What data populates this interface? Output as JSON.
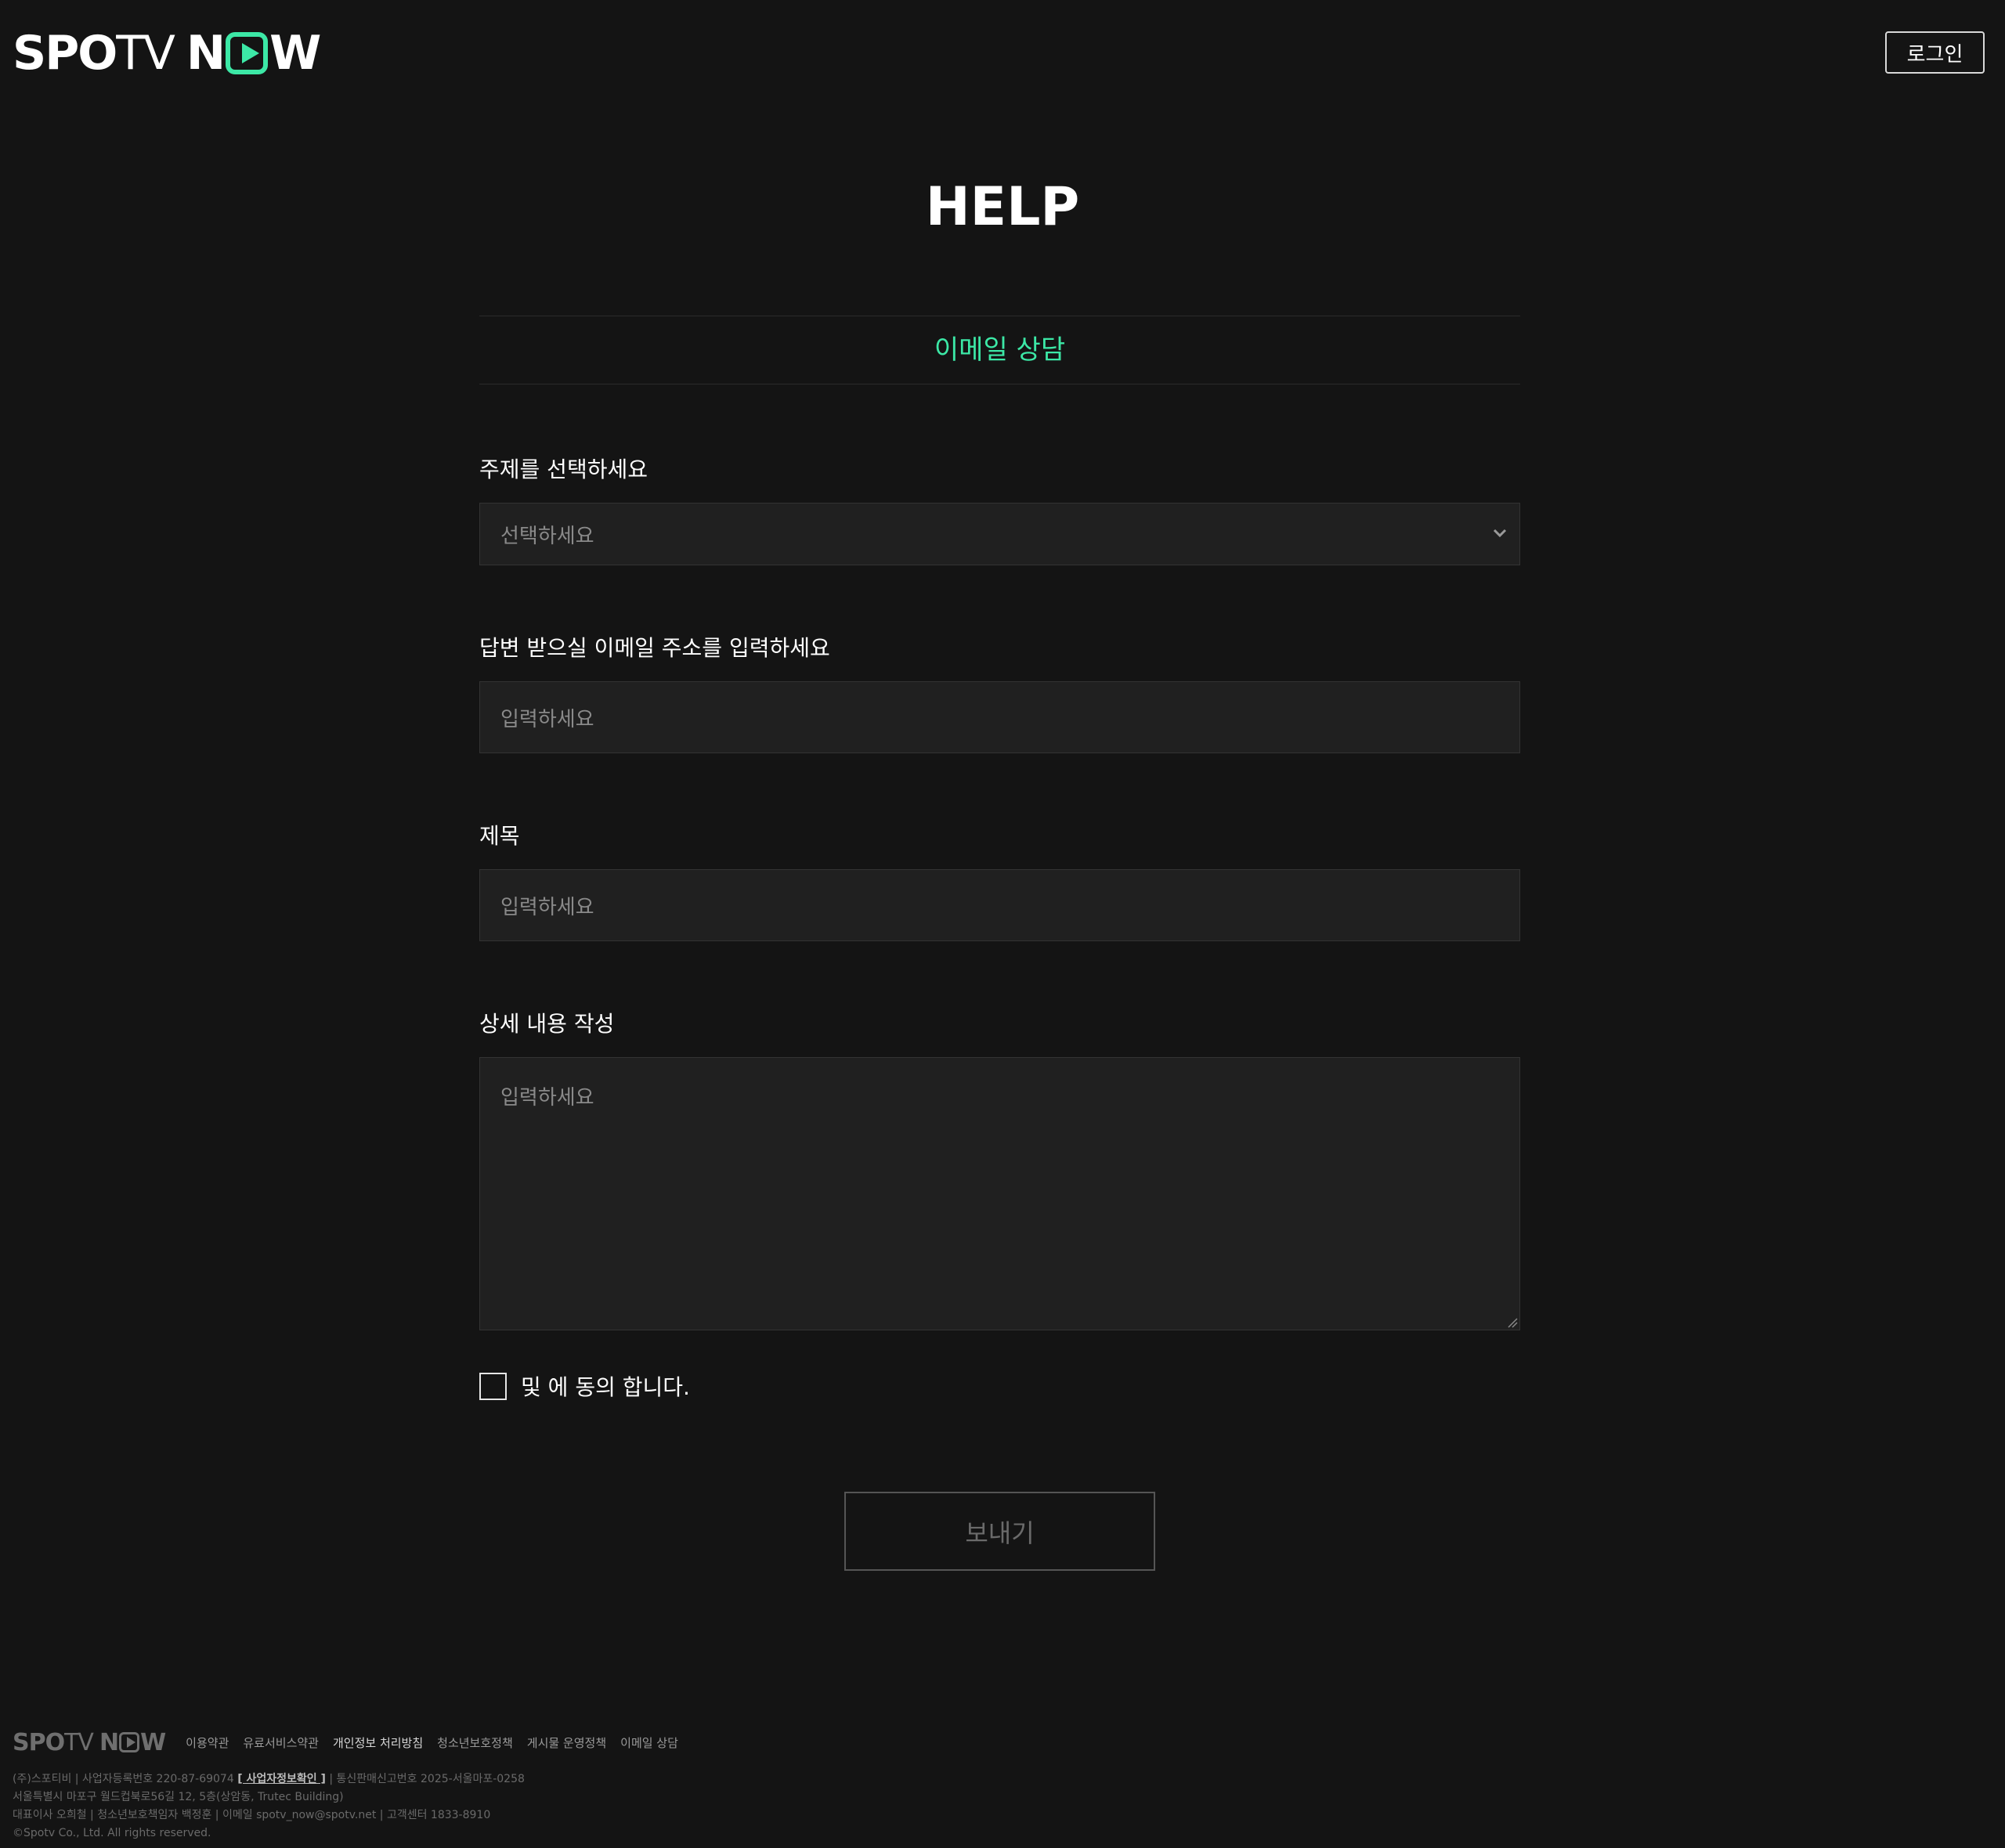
{
  "header": {
    "logo": {
      "spo": "SPO",
      "tv": "TV",
      "n": "N",
      "w": "W"
    },
    "login_label": "로그인"
  },
  "page": {
    "title": "HELP",
    "tab_label": "이메일 상담"
  },
  "form": {
    "topic_label": "주제를 선택하세요",
    "topic_selected": "선택하세요",
    "email_label": "답변 받으실 이메일 주소를 입력하세요",
    "email_placeholder": "입력하세요",
    "subject_label": "제목",
    "subject_placeholder": "입력하세요",
    "detail_label": "상세 내용 작성",
    "detail_placeholder": "입력하세요",
    "agree_text": "및 에 동의 합니다.",
    "send_label": "보내기"
  },
  "footer": {
    "logo": {
      "spo": "SPO",
      "tv": "TV",
      "n": "N",
      "w": "W"
    },
    "links": [
      "이용약관",
      "유료서비스약관",
      "개인정보 처리방침",
      "청소년보호정책",
      "게시물 운영정책",
      "이메일 상담"
    ],
    "info_line1_pre": "(주)스포티비 | 사업자등록번호 220-87-69074 ",
    "info_line1_link": "[ 사업자정보확인 ]",
    "info_line1_post": " | 통신판매신고번호 2025-서울마포-0258",
    "info_line2": "서울특별시 마포구 월드컵북로56길 12, 5층(상암동, Trutec Building)",
    "info_line3": "대표이사 오희철 | 청소년보호책임자 백정훈 | 이메일 spotv_now@spotv.net | 고객센터 1833-8910",
    "info_line4": "©Spotv Co., Ltd. All rights reserved."
  },
  "colors": {
    "background": "#141414",
    "accent": "#3ce8a6",
    "field_bg": "#202020"
  }
}
